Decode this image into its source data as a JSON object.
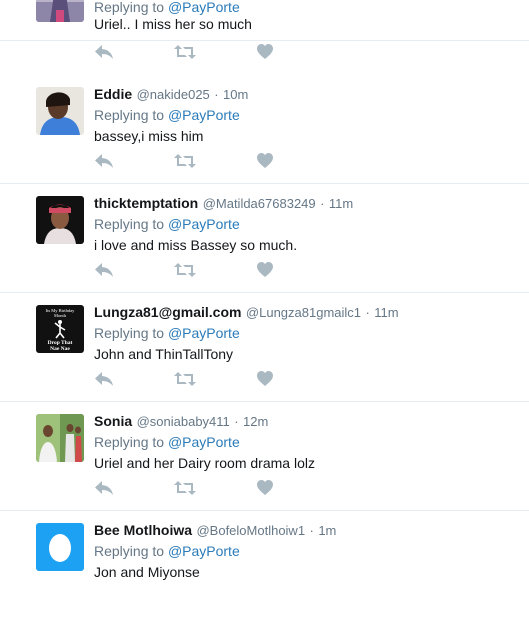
{
  "colors": {
    "accent": "#2b7bb9",
    "secondary": "#657786",
    "text": "#14171a",
    "icon": "#aab8c2",
    "border": "#e6ecf0"
  },
  "tweets": [
    {
      "replying_prefix": "Replying to",
      "mention": "@PayPorte",
      "text": "Uriel.. I miss her so much",
      "avatar": "partial-photo-avatar"
    },
    {
      "name": "Eddie",
      "handle": "@nakide025",
      "time": "10m",
      "replying_prefix": "Replying to",
      "mention": "@PayPorte",
      "text": "bassey,i miss him",
      "avatar": "selfie-avatar"
    },
    {
      "name": "thicktemptation",
      "handle": "@Matilda67683249",
      "time": "11m",
      "replying_prefix": "Replying to",
      "mention": "@PayPorte",
      "text": "i love and miss Bassey so much.",
      "avatar": "portrait-avatar"
    },
    {
      "name": "Lungza81@gmail.com",
      "handle": "@Lungza81gmailc1",
      "time": "11m",
      "replying_prefix": "Replying to",
      "mention": "@PayPorte",
      "text": "John and ThinTallTony",
      "avatar": "poster-avatar",
      "avatar_text": [
        "Its My Birthday",
        "Month",
        "Drop That",
        "Nae Nae"
      ]
    },
    {
      "name": "Sonia",
      "handle": "@soniababy411",
      "time": "12m",
      "replying_prefix": "Replying to",
      "mention": "@PayPorte",
      "text": "Uriel and her Dairy room drama lolz",
      "avatar": "collage-avatar"
    },
    {
      "name": "Bee Motlhoiwa",
      "handle": "@BofeloMotlhoiw1",
      "time": "1m",
      "replying_prefix": "Replying to",
      "mention": "@PayPorte",
      "text": "Jon and Miyonse",
      "avatar": "egg-avatar"
    }
  ],
  "separator": "·",
  "action_icons": [
    "reply-icon",
    "retweet-icon",
    "like-icon"
  ]
}
